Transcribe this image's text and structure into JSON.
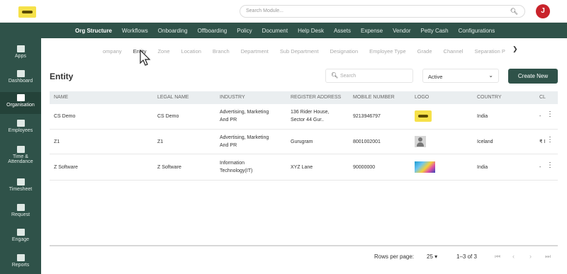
{
  "header": {
    "search_placeholder": "Search Module...",
    "avatar_initial": "J"
  },
  "main_nav": [
    "Org Structure",
    "Workflows",
    "Onboarding",
    "Offboarding",
    "Policy",
    "Document",
    "Help Desk",
    "Assets",
    "Expense",
    "Vendor",
    "Petty Cash",
    "Configurations"
  ],
  "sidebar": {
    "items": [
      {
        "label": "Apps"
      },
      {
        "label": "Dashboard"
      },
      {
        "label": "Organisation"
      },
      {
        "label": "Employees"
      },
      {
        "label": "Time &",
        "label2": "Attendance"
      },
      {
        "label": "Timesheet"
      },
      {
        "label": "Request"
      },
      {
        "label": "Engage"
      },
      {
        "label": "Reports"
      }
    ]
  },
  "sub_nav": [
    "ompany",
    "Entity",
    "Zone",
    "Location",
    "Branch",
    "Department",
    "Sub Department",
    "Designation",
    "Employee Type",
    "Grade",
    "Channel",
    "Separation P"
  ],
  "page": {
    "title": "Entity",
    "search_placeholder": "Search",
    "status_value": "Active",
    "create_label": "Create New"
  },
  "table": {
    "headers": [
      "NAME",
      "LEGAL NAME",
      "INDUSTRY",
      "REGISTER ADDRESS",
      "MOBILE NUMBER",
      "LOGO",
      "COUNTRY",
      "CL"
    ],
    "rows": [
      {
        "name": "CS Demo",
        "legal": "CS Demo",
        "industry1": "Advertising, Marketing",
        "industry2": "And PR",
        "address1": "136 Rider House,",
        "address2": "Sector 44 Gur..",
        "mobile": "9213946797",
        "country": "India",
        "cl": "-"
      },
      {
        "name": "Z1",
        "legal": "Z1",
        "industry1": "Advertising, Marketing",
        "industry2": "And PR",
        "address1": "Gurugram",
        "address2": "",
        "mobile": "8001002001",
        "country": "Iceland",
        "cl": "₹ I"
      },
      {
        "name": "Z Software",
        "legal": "Z Software",
        "industry1": "Information",
        "industry2": "Technology(IT)",
        "address1": "XYZ Lane",
        "address2": "",
        "mobile": "90000000",
        "country": "India",
        "cl": "-"
      }
    ]
  },
  "pagination": {
    "rows_per_page_label": "Rows per page:",
    "rows_per_page_value": "25",
    "range": "1–3 of 3"
  },
  "colors": {
    "primary": "#2f5249",
    "avatar": "#c9232b"
  }
}
